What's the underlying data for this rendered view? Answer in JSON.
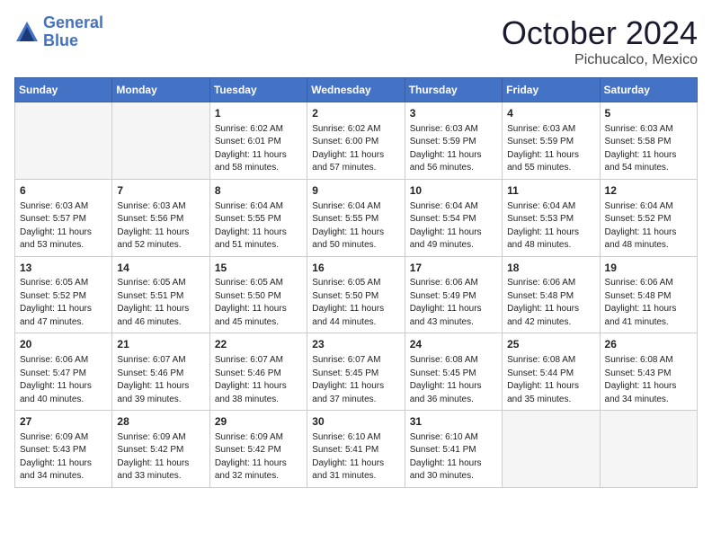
{
  "header": {
    "logo_line1": "General",
    "logo_line2": "Blue",
    "month_title": "October 2024",
    "location": "Pichucalco, Mexico"
  },
  "days_of_week": [
    "Sunday",
    "Monday",
    "Tuesday",
    "Wednesday",
    "Thursday",
    "Friday",
    "Saturday"
  ],
  "weeks": [
    [
      {
        "day": "",
        "empty": true
      },
      {
        "day": "",
        "empty": true
      },
      {
        "day": "1",
        "info": "Sunrise: 6:02 AM\nSunset: 6:01 PM\nDaylight: 11 hours and 58 minutes."
      },
      {
        "day": "2",
        "info": "Sunrise: 6:02 AM\nSunset: 6:00 PM\nDaylight: 11 hours and 57 minutes."
      },
      {
        "day": "3",
        "info": "Sunrise: 6:03 AM\nSunset: 5:59 PM\nDaylight: 11 hours and 56 minutes."
      },
      {
        "day": "4",
        "info": "Sunrise: 6:03 AM\nSunset: 5:59 PM\nDaylight: 11 hours and 55 minutes."
      },
      {
        "day": "5",
        "info": "Sunrise: 6:03 AM\nSunset: 5:58 PM\nDaylight: 11 hours and 54 minutes."
      }
    ],
    [
      {
        "day": "6",
        "info": "Sunrise: 6:03 AM\nSunset: 5:57 PM\nDaylight: 11 hours and 53 minutes."
      },
      {
        "day": "7",
        "info": "Sunrise: 6:03 AM\nSunset: 5:56 PM\nDaylight: 11 hours and 52 minutes."
      },
      {
        "day": "8",
        "info": "Sunrise: 6:04 AM\nSunset: 5:55 PM\nDaylight: 11 hours and 51 minutes."
      },
      {
        "day": "9",
        "info": "Sunrise: 6:04 AM\nSunset: 5:55 PM\nDaylight: 11 hours and 50 minutes."
      },
      {
        "day": "10",
        "info": "Sunrise: 6:04 AM\nSunset: 5:54 PM\nDaylight: 11 hours and 49 minutes."
      },
      {
        "day": "11",
        "info": "Sunrise: 6:04 AM\nSunset: 5:53 PM\nDaylight: 11 hours and 48 minutes."
      },
      {
        "day": "12",
        "info": "Sunrise: 6:04 AM\nSunset: 5:52 PM\nDaylight: 11 hours and 48 minutes."
      }
    ],
    [
      {
        "day": "13",
        "info": "Sunrise: 6:05 AM\nSunset: 5:52 PM\nDaylight: 11 hours and 47 minutes."
      },
      {
        "day": "14",
        "info": "Sunrise: 6:05 AM\nSunset: 5:51 PM\nDaylight: 11 hours and 46 minutes."
      },
      {
        "day": "15",
        "info": "Sunrise: 6:05 AM\nSunset: 5:50 PM\nDaylight: 11 hours and 45 minutes."
      },
      {
        "day": "16",
        "info": "Sunrise: 6:05 AM\nSunset: 5:50 PM\nDaylight: 11 hours and 44 minutes."
      },
      {
        "day": "17",
        "info": "Sunrise: 6:06 AM\nSunset: 5:49 PM\nDaylight: 11 hours and 43 minutes."
      },
      {
        "day": "18",
        "info": "Sunrise: 6:06 AM\nSunset: 5:48 PM\nDaylight: 11 hours and 42 minutes."
      },
      {
        "day": "19",
        "info": "Sunrise: 6:06 AM\nSunset: 5:48 PM\nDaylight: 11 hours and 41 minutes."
      }
    ],
    [
      {
        "day": "20",
        "info": "Sunrise: 6:06 AM\nSunset: 5:47 PM\nDaylight: 11 hours and 40 minutes."
      },
      {
        "day": "21",
        "info": "Sunrise: 6:07 AM\nSunset: 5:46 PM\nDaylight: 11 hours and 39 minutes."
      },
      {
        "day": "22",
        "info": "Sunrise: 6:07 AM\nSunset: 5:46 PM\nDaylight: 11 hours and 38 minutes."
      },
      {
        "day": "23",
        "info": "Sunrise: 6:07 AM\nSunset: 5:45 PM\nDaylight: 11 hours and 37 minutes."
      },
      {
        "day": "24",
        "info": "Sunrise: 6:08 AM\nSunset: 5:45 PM\nDaylight: 11 hours and 36 minutes."
      },
      {
        "day": "25",
        "info": "Sunrise: 6:08 AM\nSunset: 5:44 PM\nDaylight: 11 hours and 35 minutes."
      },
      {
        "day": "26",
        "info": "Sunrise: 6:08 AM\nSunset: 5:43 PM\nDaylight: 11 hours and 34 minutes."
      }
    ],
    [
      {
        "day": "27",
        "info": "Sunrise: 6:09 AM\nSunset: 5:43 PM\nDaylight: 11 hours and 34 minutes."
      },
      {
        "day": "28",
        "info": "Sunrise: 6:09 AM\nSunset: 5:42 PM\nDaylight: 11 hours and 33 minutes."
      },
      {
        "day": "29",
        "info": "Sunrise: 6:09 AM\nSunset: 5:42 PM\nDaylight: 11 hours and 32 minutes."
      },
      {
        "day": "30",
        "info": "Sunrise: 6:10 AM\nSunset: 5:41 PM\nDaylight: 11 hours and 31 minutes."
      },
      {
        "day": "31",
        "info": "Sunrise: 6:10 AM\nSunset: 5:41 PM\nDaylight: 11 hours and 30 minutes."
      },
      {
        "day": "",
        "empty": true
      },
      {
        "day": "",
        "empty": true
      }
    ]
  ]
}
